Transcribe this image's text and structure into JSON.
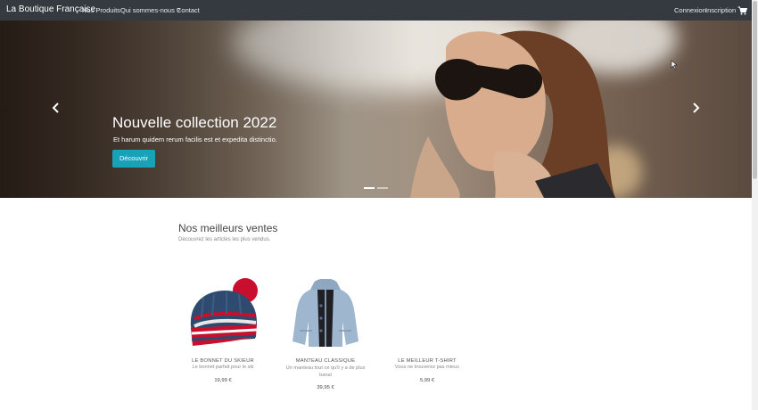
{
  "navbar": {
    "brand": "La Boutique Française",
    "links": [
      "Nos Produits",
      "Qui sommes-nous ?",
      "Contact"
    ],
    "login": "Connexion",
    "signup": "Inscription",
    "cart_icon": "cart-icon"
  },
  "hero": {
    "title": "Nouvelle collection 2022",
    "subtitle": "Et harum quidem rerum facilis est et expedita distinctio.",
    "button": "Découvrir",
    "slide_count": 2,
    "active_slide": 1
  },
  "bestsellers": {
    "title": "Nos meilleurs ventes",
    "subtitle": "Découvrez les articles les plus vendus.",
    "products": [
      {
        "name": "LE BONNET DU SKIEUR",
        "description": "Le bonnet parfait pour le ski",
        "price": "19,99 €"
      },
      {
        "name": "MANTEAU CLASSIQUE",
        "description": "Un manteau tout ce qu'il y a de plus banal",
        "price": "39,95 €"
      },
      {
        "name": "LE MEILLEUR T-SHIRT",
        "description": "Vous ne trouverez pas mieux",
        "price": "5,99 €"
      }
    ]
  }
}
